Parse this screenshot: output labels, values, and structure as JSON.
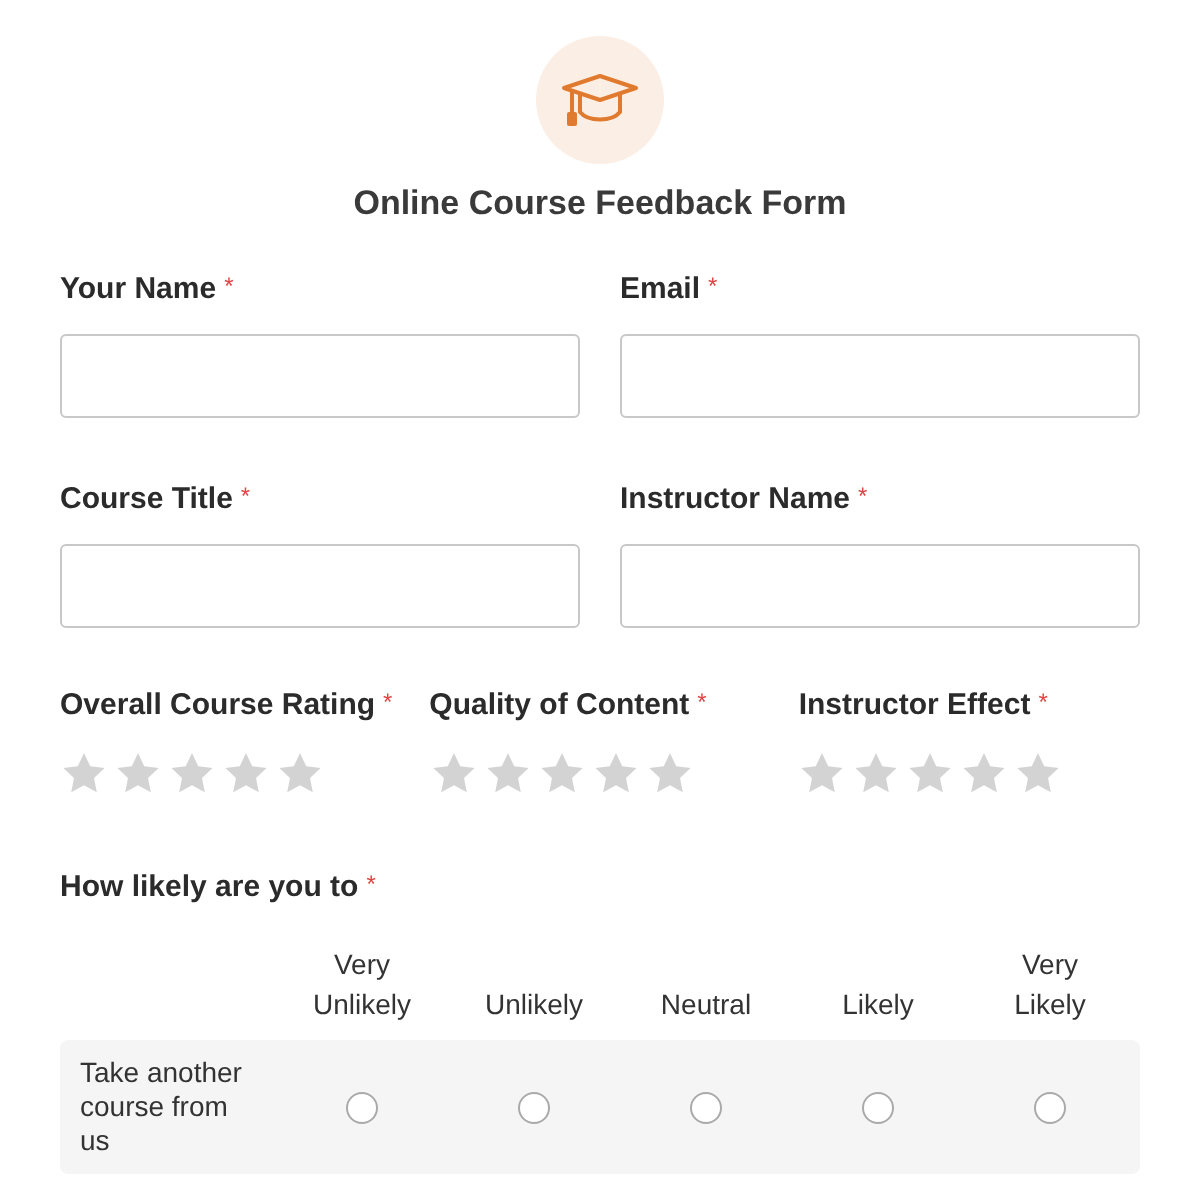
{
  "form": {
    "title": "Online Course Feedback Form"
  },
  "required_mark": "*",
  "fields": [
    {
      "label": "Your Name",
      "required": true
    },
    {
      "label": "Email",
      "required": true
    },
    {
      "label": "Course Title",
      "required": true
    },
    {
      "label": "Instructor Name",
      "required": true
    }
  ],
  "ratings": [
    {
      "label": "Overall Course Rating",
      "required": true,
      "stars": 0
    },
    {
      "label": "Quality of Content",
      "required": true,
      "stars": 0
    },
    {
      "label": "Instructor Effect",
      "required": true,
      "stars": 0
    }
  ],
  "matrix": {
    "label": "How likely are you to",
    "required": true,
    "columns": [
      "Very Unlikely",
      "Unlikely",
      "Neutral",
      "Likely",
      "Very Likely"
    ],
    "rows": [
      {
        "label": "Take another course from us",
        "choices": [
          {
            "selected": false
          },
          {
            "selected": false
          },
          {
            "selected": false
          },
          {
            "selected": false
          },
          {
            "selected": false
          }
        ]
      }
    ]
  }
}
